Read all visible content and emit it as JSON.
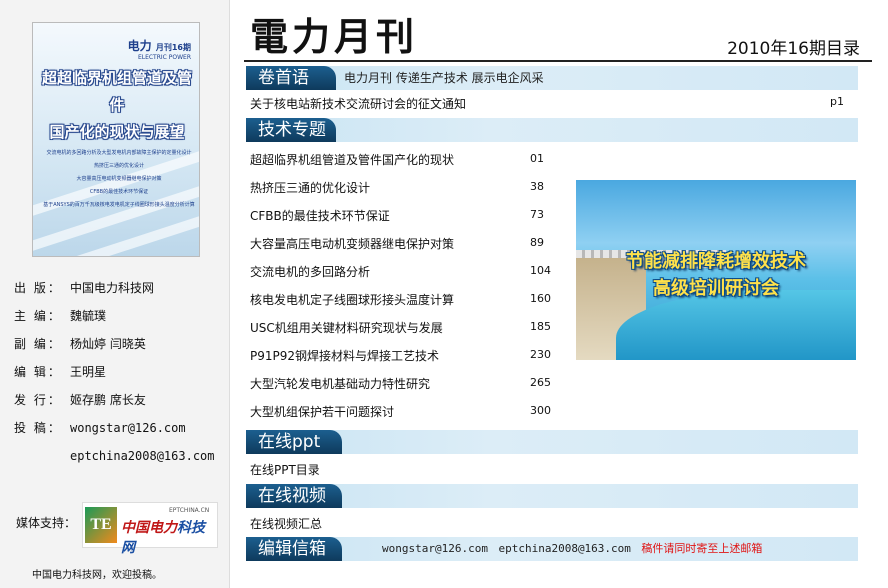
{
  "cover": {
    "brand": "电力",
    "issue_label": "月刊16期",
    "brand_en": "ELECTRIC POWER",
    "headline_line1": "超超临界机组管道及管件",
    "headline_line2": "国产化的现状与展望",
    "article_lines": [
      "交流电机的多回路分析及大型发电机内部故障主保护的定量化设计",
      "热挤压三通的优化设计",
      "大容量高压电动机变频器继电保护对策",
      "CFBB的最佳技术环节保证",
      "基于ANSYS的百万千瓦级核电发电机定子线圈球形接头温度分析计算"
    ]
  },
  "meta": [
    {
      "key": "出  版：",
      "value": "中国电力科技网"
    },
    {
      "key": "主  编：",
      "value": "魏毓璞"
    },
    {
      "key": "副  编：",
      "value": "杨灿婷  闫晓英"
    },
    {
      "key": "编  辑：",
      "value": "王明星"
    },
    {
      "key": "发  行：",
      "value": "姬存鹏  席长友"
    },
    {
      "key": "投  稿：",
      "value": "wongstar@126.com"
    },
    {
      "key": "",
      "value": "eptchina2008@163.com"
    }
  ],
  "media": {
    "label": "媒体支持：",
    "logo_badge": "TE",
    "logo_text_a": "中国电力",
    "logo_text_b": "科技网",
    "logo_site": "EPTCHINA.CN"
  },
  "footer": "中国电力科技网，欢迎投稿。",
  "header": {
    "title": "電力月刊",
    "issue": "2010年16期目录"
  },
  "sections": {
    "foreword": {
      "label": "卷首语",
      "slogan": "电力月刊 传递生产技术  展示电企风采"
    },
    "tech": {
      "label": "技术专题"
    },
    "ppt": {
      "label": "在线ppt"
    },
    "video": {
      "label": "在线视频"
    },
    "mailbox": {
      "label": "编辑信箱"
    }
  },
  "foreword_item": {
    "title": "关于核电站新技术交流研讨会的征文通知",
    "page": "p1"
  },
  "tech_items": [
    {
      "title": "超超临界机组管道及管件国产化的现状",
      "page": "01"
    },
    {
      "title": "热挤压三通的优化设计",
      "page": "38"
    },
    {
      "title": "CFBB的最佳技术环节保证",
      "page": "73"
    },
    {
      "title": "大容量高压电动机变频器继电保护对策",
      "page": "89"
    },
    {
      "title": "交流电机的多回路分析",
      "page": "104"
    },
    {
      "title": "核电发电机定子线圈球形接头温度计算",
      "page": "160"
    },
    {
      "title": "USC机组用关键材料研究现状与发展",
      "page": "185"
    },
    {
      "title": "P91P92钢焊接材料与焊接工艺技术",
      "page": "230"
    },
    {
      "title": "大型汽轮发电机基础动力特性研究",
      "page": "265"
    },
    {
      "title": "大型机组保护若干问题探讨",
      "page": "300"
    }
  ],
  "banner": {
    "line1": "节能减排降耗增效技术",
    "line2": "高级培训研讨会"
  },
  "ppt_item": "在线PPT目录",
  "video_item": "在线视频汇总",
  "mailbox": {
    "email1": "wongstar@126.com",
    "email2": "eptchina2008@163.com",
    "note": "稿件请同时寄至上述邮箱"
  },
  "colors": {
    "bar_label": "#0e3a5c",
    "bar_bg": "#d2e8f5",
    "note_red": "#e01515"
  }
}
